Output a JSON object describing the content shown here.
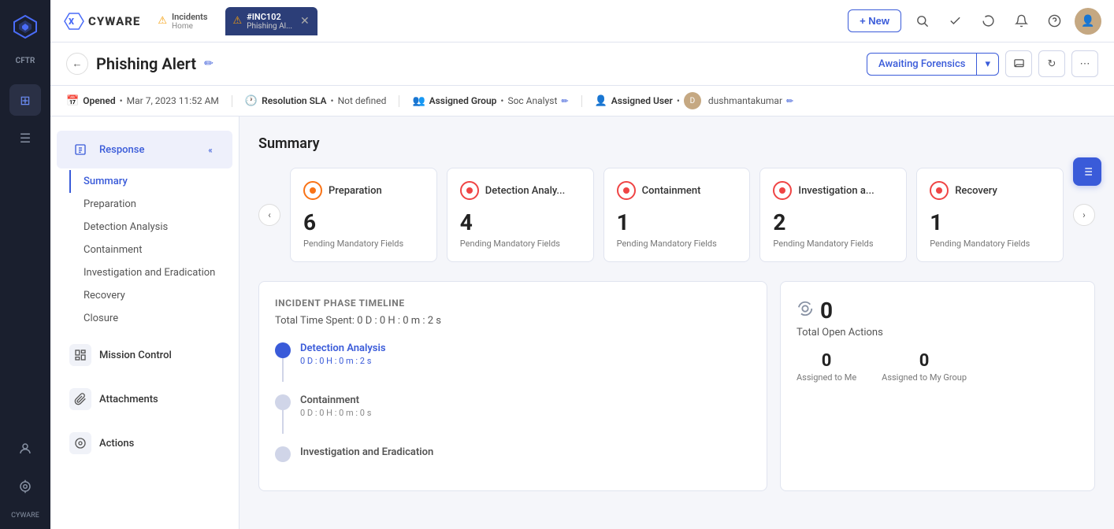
{
  "sidebar": {
    "label": "CFTR",
    "cyware_label": "CYWARE",
    "icons": [
      {
        "name": "grid-icon",
        "symbol": "⊞",
        "active": true
      },
      {
        "name": "menu-icon",
        "symbol": "☰",
        "active": false
      },
      {
        "name": "user-icon",
        "symbol": "👤",
        "active": false
      },
      {
        "name": "target-icon",
        "symbol": "◎",
        "active": false
      }
    ]
  },
  "topbar": {
    "logo_text": "CYWARE",
    "new_button": "+ New",
    "tabs": [
      {
        "id": "incidents",
        "label": "Incidents",
        "sub": "Home",
        "active": false
      },
      {
        "id": "inc102",
        "label": "#INC102",
        "sub": "Phishing Al...",
        "active": true,
        "closable": true
      }
    ],
    "icons": [
      {
        "name": "search-icon",
        "symbol": "🔍"
      },
      {
        "name": "check-icon",
        "symbol": "✓"
      },
      {
        "name": "loader-icon",
        "symbol": "⟳"
      },
      {
        "name": "bell-icon",
        "symbol": "🔔"
      },
      {
        "name": "help-icon",
        "symbol": "?"
      }
    ]
  },
  "page_header": {
    "title": "Phishing Alert",
    "status": "Awaiting Forensics",
    "icons": [
      {
        "name": "feedback-icon",
        "symbol": "💬"
      },
      {
        "name": "refresh-icon",
        "symbol": "↻"
      },
      {
        "name": "more-icon",
        "symbol": "⋯"
      }
    ]
  },
  "meta_bar": {
    "opened_label": "Opened",
    "opened_value": "Mar 7, 2023 11:52 AM",
    "sla_label": "Resolution SLA",
    "sla_value": "Not defined",
    "group_label": "Assigned Group",
    "group_value": "Soc Analyst",
    "user_label": "Assigned User",
    "user_value": "dushmantakumar"
  },
  "left_nav": {
    "sections": [
      {
        "id": "response",
        "label": "Response",
        "icon": "📋",
        "active": true,
        "sub_items": [
          {
            "id": "summary",
            "label": "Summary",
            "active": true
          },
          {
            "id": "preparation",
            "label": "Preparation",
            "active": false
          },
          {
            "id": "detection-analysis",
            "label": "Detection Analysis",
            "active": false
          },
          {
            "id": "containment",
            "label": "Containment",
            "active": false
          },
          {
            "id": "investigation",
            "label": "Investigation and Eradication",
            "active": false
          },
          {
            "id": "recovery",
            "label": "Recovery",
            "active": false
          },
          {
            "id": "closure",
            "label": "Closure",
            "active": false
          }
        ]
      },
      {
        "id": "mission-control",
        "label": "Mission Control",
        "icon": "📝",
        "active": false,
        "sub_items": []
      },
      {
        "id": "attachments",
        "label": "Attachments",
        "icon": "🔗",
        "active": false,
        "sub_items": []
      },
      {
        "id": "actions",
        "label": "Actions",
        "icon": "◎",
        "active": false,
        "sub_items": []
      }
    ]
  },
  "summary": {
    "title": "Summary",
    "phase_cards": [
      {
        "id": "preparation",
        "name": "Preparation",
        "count": "6",
        "desc": "Pending Mandatory Fields",
        "circle_type": "orange"
      },
      {
        "id": "detection",
        "name": "Detection Analy...",
        "count": "4",
        "desc": "Pending Mandatory Fields",
        "circle_type": "red"
      },
      {
        "id": "containment",
        "name": "Containment",
        "count": "1",
        "desc": "Pending Mandatory Fields",
        "circle_type": "red"
      },
      {
        "id": "investigation",
        "name": "Investigation a...",
        "count": "2",
        "desc": "Pending Mandatory Fields",
        "circle_type": "red"
      },
      {
        "id": "recovery",
        "name": "Recovery",
        "count": "1",
        "desc": "Pending Mandatory Fields",
        "circle_type": "red"
      }
    ],
    "timeline": {
      "title": "INCIDENT PHASE TIMELINE",
      "total_label": "Total Time Spent:",
      "total_value": "0 D : 0 H : 0 m : 2 s",
      "items": [
        {
          "name": "Detection Analysis",
          "time": "0 D : 0 H : 0 m : 2 s",
          "active": true
        },
        {
          "name": "Containment",
          "time": "0 D : 0 H : 0 m : 0 s",
          "active": false
        },
        {
          "name": "Investigation and Eradication",
          "time": "",
          "active": false
        }
      ]
    },
    "open_actions": {
      "icon": "◎",
      "count": "0",
      "label": "Total Open Actions",
      "assigned_me": "0",
      "assigned_me_label": "Assigned to Me",
      "assigned_group": "0",
      "assigned_group_label": "Assigned to My Group"
    }
  }
}
